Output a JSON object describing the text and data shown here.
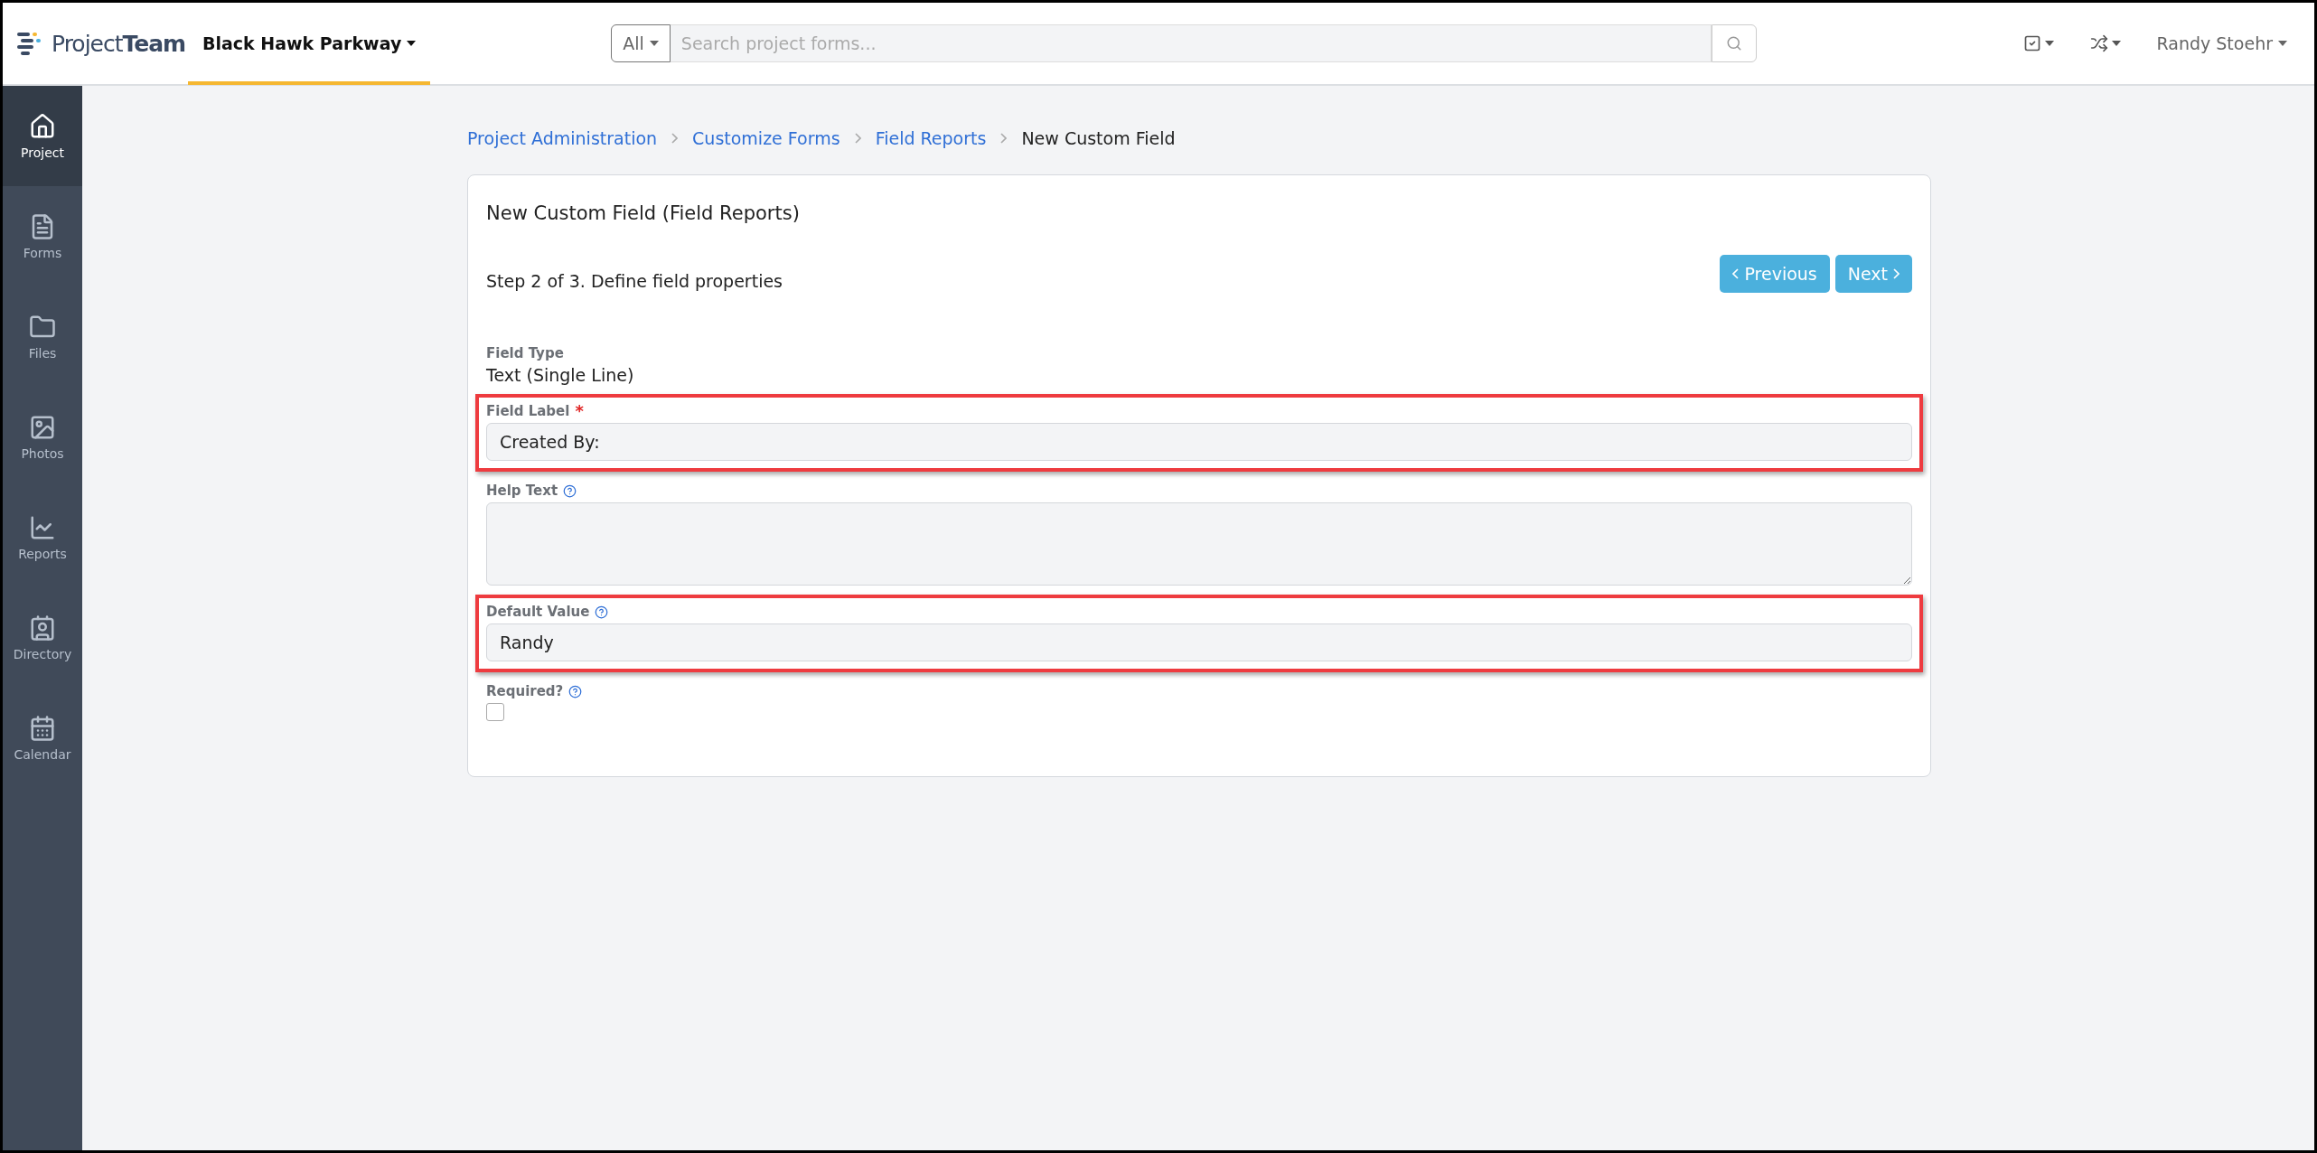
{
  "header": {
    "logo": "Project**Team**",
    "project": {
      "name": "Black Hawk Parkway",
      "selected": true
    },
    "search": {
      "scope": "All",
      "placeholder": "Search project forms..."
    },
    "user": "Randy Stoehr"
  },
  "sidebar": {
    "items": [
      {
        "label": "Project",
        "selected": true
      },
      {
        "label": "Forms",
        "selected": false
      },
      {
        "label": "Files",
        "selected": false
      },
      {
        "label": "Photos",
        "selected": false
      },
      {
        "label": "Reports",
        "selected": false
      },
      {
        "label": "Directory",
        "selected": false
      },
      {
        "label": "Calendar",
        "selected": false
      }
    ]
  },
  "breadcrumbs": [
    {
      "label": "Project Administration",
      "link": true
    },
    {
      "label": "Customize Forms",
      "link": true
    },
    {
      "label": "Field Reports",
      "link": true
    },
    {
      "label": "New Custom Field",
      "link": false
    }
  ],
  "card": {
    "title": "New Custom Field (Field Reports)",
    "step": "Step 2 of 3. Define field properties",
    "buttons": [
      {
        "label": "Previous",
        "kind": "prev"
      },
      {
        "label": "Next",
        "kind": "next"
      }
    ],
    "fields": [
      {
        "kind": "static",
        "label": "Field Type",
        "value": "Text (Single Line)",
        "help": false,
        "highlighted": false
      },
      {
        "kind": "text",
        "label": "Field Label",
        "required_mark": "*",
        "value": "Created By:",
        "help": false,
        "highlighted": true
      },
      {
        "kind": "textarea",
        "label": "Help Text",
        "help": true,
        "highlighted": false
      },
      {
        "kind": "text",
        "label": "Default Value",
        "value": "Randy",
        "help": true,
        "highlighted": true
      },
      {
        "kind": "checkbox",
        "label": "Required?",
        "checked": false,
        "help": true,
        "highlighted": false
      }
    ]
  }
}
